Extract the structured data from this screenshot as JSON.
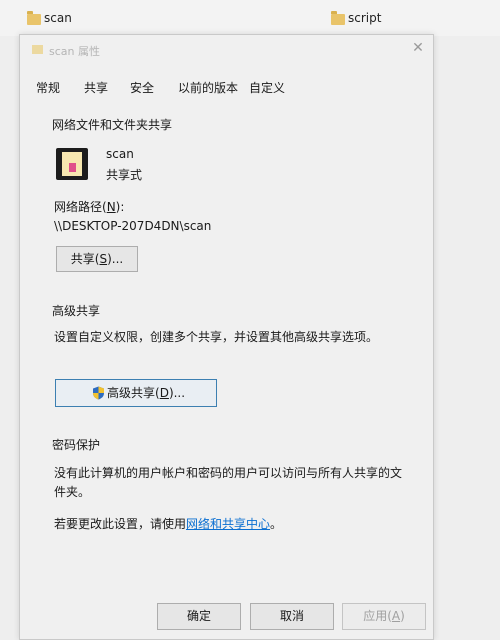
{
  "explorer": {
    "folder_left": "scan",
    "folder_right": "script"
  },
  "dialog": {
    "title": "scan 属性",
    "tabs": [
      "常规",
      "共享",
      "安全",
      "以前的版本",
      "自定义"
    ],
    "network_section_title": "网络文件和文件夹共享",
    "item_name": "scan",
    "item_status": "共享式",
    "network_path_label_pre": "网络路径(",
    "network_path_label_key": "N",
    "network_path_label_post": "):",
    "network_path_value": "\\\\DESKTOP-207D4DN\\scan",
    "share_button": {
      "pre": "共享(",
      "key": "S",
      "post": ")..."
    },
    "advanced_section_title": "高级共享",
    "advanced_desc": "设置自定义权限，创建多个共享，并设置其他高级共享选项。",
    "advanced_button": {
      "pre": "高级共享(",
      "key": "D",
      "post": ")..."
    },
    "password_section_title": "密码保护",
    "password_desc_line1": "没有此计算机的用户帐户和密码的用户可以访问与所有人共享的文",
    "password_desc_line2": "件夹。",
    "change_prefix": "若要更改此设置，请使用",
    "change_link": "网络和共享中心",
    "change_suffix": "。",
    "ok_button": "确定",
    "cancel_button": "取消",
    "apply_button": {
      "pre": "应用(",
      "key": "A",
      "post": ")"
    }
  }
}
